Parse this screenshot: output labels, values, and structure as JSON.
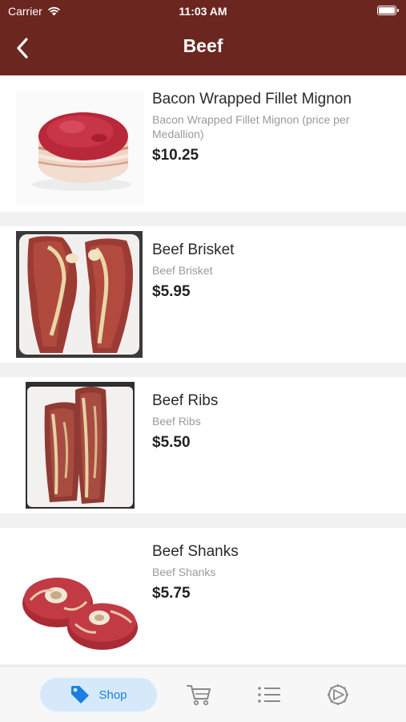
{
  "status_bar": {
    "carrier": "Carrier",
    "time": "11:03 AM",
    "battery": 1.0
  },
  "nav": {
    "title": "Beef",
    "back_icon": "chevron-left-icon"
  },
  "products": [
    {
      "name": "Bacon Wrapped Fillet Mignon",
      "description": "Bacon Wrapped Fillet Mignon (price per Medallion)",
      "price": "$10.25",
      "image": "bacon-wrapped-fillet-image"
    },
    {
      "name": "Beef Brisket",
      "description": "Beef Brisket",
      "price": "$5.95",
      "image": "beef-brisket-image"
    },
    {
      "name": "Beef Ribs",
      "description": "Beef Ribs",
      "price": "$5.50",
      "image": "beef-ribs-image"
    },
    {
      "name": "Beef Shanks",
      "description": "Beef Shanks",
      "price": "$5.75",
      "image": "beef-shanks-image"
    }
  ],
  "tabbar": {
    "shop_label": "Shop",
    "icons": [
      "tag-icon",
      "cart-icon",
      "list-icon",
      "settings-icon"
    ],
    "accent_color": "#1a7fe0",
    "inactive_color": "#8a8a8a"
  },
  "colors": {
    "header": "#6b2620",
    "tab_active_bg": "#d6e9fb"
  }
}
